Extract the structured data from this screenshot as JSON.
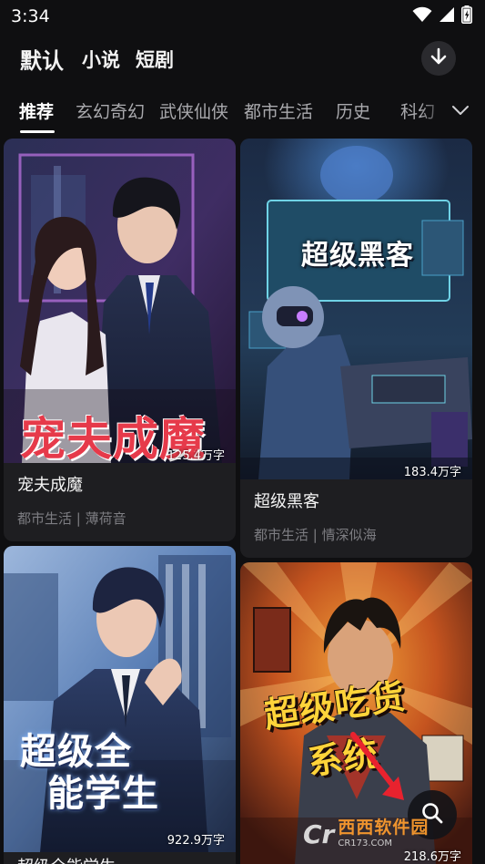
{
  "status_bar": {
    "time": "3:34"
  },
  "top_tabs": [
    {
      "label": "默认",
      "active": true
    },
    {
      "label": "小说",
      "active": false
    },
    {
      "label": "短剧",
      "active": false
    }
  ],
  "categories": [
    {
      "label": "推荐",
      "active": true
    },
    {
      "label": "玄幻奇幻",
      "active": false
    },
    {
      "label": "武侠仙侠",
      "active": false
    },
    {
      "label": "都市生活",
      "active": false
    },
    {
      "label": "历史",
      "active": false
    },
    {
      "label": "科幻",
      "active": false
    }
  ],
  "books": [
    {
      "title": "宠夫成魔",
      "word_count": "125.4万字",
      "category": "都市生活",
      "author": "薄荷音",
      "meta": "都市生活 | 薄荷音",
      "cover_text": "宠夫成魔"
    },
    {
      "title": "超级黑客",
      "word_count": "183.4万字",
      "category": "都市生活",
      "author": "情深似海",
      "meta": "都市生活 | 情深似海",
      "cover_text": "超级黑客"
    },
    {
      "title": "超级全能学生",
      "word_count": "922.9万字",
      "cover_text_1": "超级全",
      "cover_text_2": "能学生"
    },
    {
      "title": "超级吃货系统",
      "word_count": "218.6万字",
      "cover_text_1": "超级吃货",
      "cover_text_2": "系统"
    }
  ],
  "watermark": {
    "logo": "Cr",
    "name": "西西软件园",
    "url": "CR173.COM"
  },
  "icons": {
    "download": "arrow-down-icon",
    "category_more": "chevron-down-icon",
    "search": "search-icon"
  },
  "colors": {
    "background": "#0f0f11",
    "card": "#1e1e21",
    "title_red": "#e63a4a",
    "title_orange": "#ff8a1c"
  }
}
